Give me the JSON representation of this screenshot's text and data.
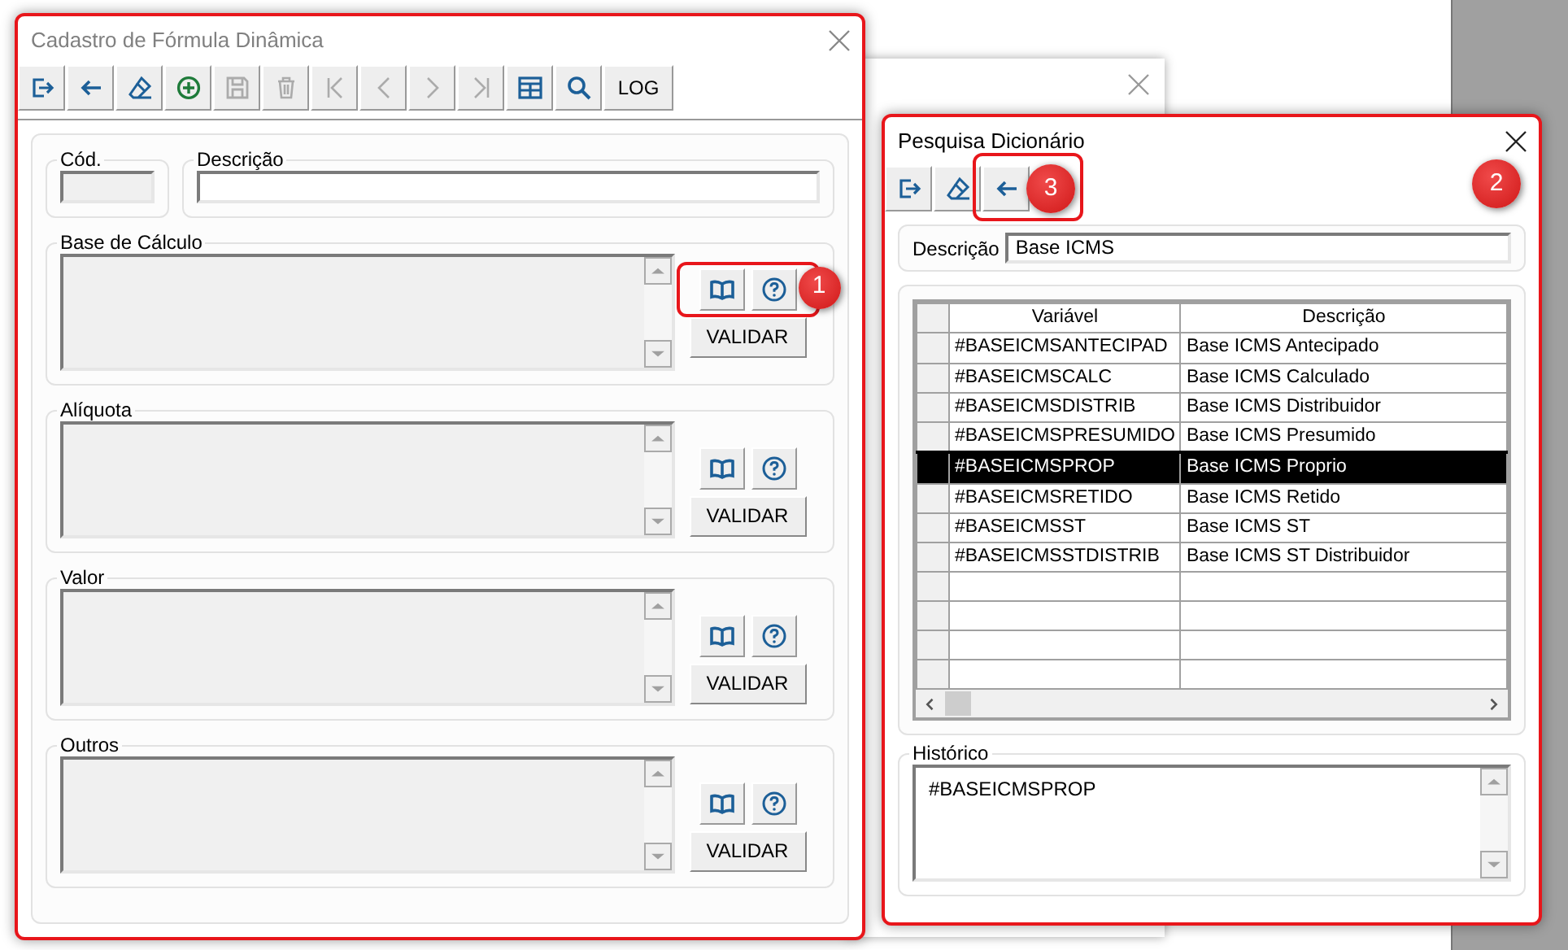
{
  "formula_dialog": {
    "title": "Cadastro de Fórmula Dinâmica",
    "toolbar": [
      {
        "kind": "exit",
        "disabled": false
      },
      {
        "kind": "back",
        "disabled": false
      },
      {
        "kind": "eraser",
        "disabled": false
      },
      {
        "kind": "add",
        "disabled": false
      },
      {
        "kind": "save",
        "disabled": true
      },
      {
        "kind": "trash",
        "disabled": true
      },
      {
        "kind": "first",
        "disabled": true
      },
      {
        "kind": "prev",
        "disabled": true
      },
      {
        "kind": "next",
        "disabled": true
      },
      {
        "kind": "last",
        "disabled": true
      },
      {
        "kind": "table",
        "disabled": false
      },
      {
        "kind": "search",
        "disabled": false
      },
      {
        "kind": "text",
        "label": "LOG",
        "disabled": false
      }
    ],
    "fields": [
      {
        "label": "Cód.",
        "disabled": true
      },
      {
        "label": "Descrição",
        "disabled": false
      }
    ],
    "sections": [
      {
        "title": "Base de Cálculo",
        "button": "VALIDAR",
        "callout": "1"
      },
      {
        "title": "Alíquota",
        "button": "VALIDAR"
      },
      {
        "title": "Valor",
        "button": "VALIDAR"
      },
      {
        "title": "Outros",
        "button": "VALIDAR"
      }
    ]
  },
  "dictionary_dialog": {
    "title": "Pesquisa Dicionário",
    "callout": "2",
    "toolbar": [
      {
        "kind": "exit"
      },
      {
        "kind": "eraser"
      },
      {
        "kind": "back",
        "callout": "3"
      }
    ],
    "search": {
      "label": "Descrição",
      "value": "Base ICMS"
    },
    "table": {
      "columns": [
        "Variável",
        "Descrição"
      ],
      "rows": [
        {
          "cells": [
            "#BASEICMSANTECIPAD",
            "Base ICMS Antecipado"
          ],
          "selected": false
        },
        {
          "cells": [
            "#BASEICMSCALC",
            "Base ICMS Calculado"
          ],
          "selected": false
        },
        {
          "cells": [
            "#BASEICMSDISTRIB",
            "Base ICMS Distribuidor"
          ],
          "selected": false
        },
        {
          "cells": [
            "#BASEICMSPRESUMIDO",
            "Base ICMS Presumido"
          ],
          "selected": false
        },
        {
          "cells": [
            "#BASEICMSPROP",
            "Base ICMS Proprio"
          ],
          "selected": true
        },
        {
          "cells": [
            "#BASEICMSRETIDO",
            "Base ICMS Retido"
          ],
          "selected": false
        },
        {
          "cells": [
            "#BASEICMSST",
            "Base ICMS ST"
          ],
          "selected": false
        },
        {
          "cells": [
            "#BASEICMSSTDISTRIB",
            "Base ICMS ST Distribuidor"
          ],
          "selected": false
        }
      ]
    },
    "history": {
      "label": "Histórico",
      "value": "#BASEICMSPROP"
    }
  }
}
